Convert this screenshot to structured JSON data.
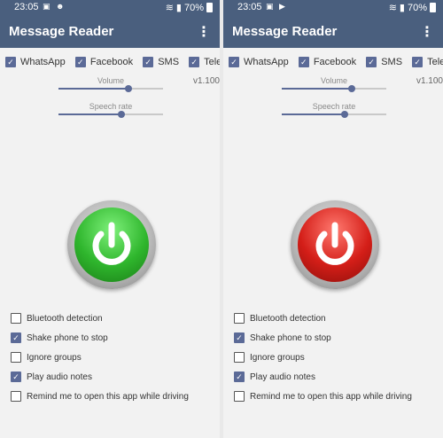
{
  "screens": [
    {
      "status": {
        "time": "23:05",
        "battery": "70%"
      },
      "app_title": "Message Reader",
      "apps": [
        {
          "label": "WhatsApp",
          "checked": true
        },
        {
          "label": "Facebook",
          "checked": true
        },
        {
          "label": "SMS",
          "checked": true
        },
        {
          "label": "Telegram",
          "checked": true
        }
      ],
      "version": "v1.100",
      "volume": {
        "label": "Volume",
        "level": 0.67
      },
      "speech_rate": {
        "label": "Speech rate",
        "level": 0.6
      },
      "power": {
        "state": "on",
        "color": "#2fb62d"
      },
      "options": [
        {
          "label": "Bluetooth detection",
          "checked": false
        },
        {
          "label": "Shake phone to stop",
          "checked": true
        },
        {
          "label": "Ignore groups",
          "checked": false
        },
        {
          "label": "Play audio notes",
          "checked": true
        },
        {
          "label": "Remind me to open this app while driving",
          "checked": false
        }
      ]
    },
    {
      "status": {
        "time": "23:05",
        "battery": "70%"
      },
      "app_title": "Message Reader",
      "apps": [
        {
          "label": "WhatsApp",
          "checked": true
        },
        {
          "label": "Facebook",
          "checked": true
        },
        {
          "label": "SMS",
          "checked": true
        },
        {
          "label": "Telegram",
          "checked": true
        }
      ],
      "version": "v1.100",
      "volume": {
        "label": "Volume",
        "level": 0.67
      },
      "speech_rate": {
        "label": "Speech rate",
        "level": 0.6
      },
      "power": {
        "state": "off",
        "color": "#d41e18"
      },
      "options": [
        {
          "label": "Bluetooth detection",
          "checked": false
        },
        {
          "label": "Shake phone to stop",
          "checked": true
        },
        {
          "label": "Ignore groups",
          "checked": false
        },
        {
          "label": "Play audio notes",
          "checked": true
        },
        {
          "label": "Remind me to open this app while driving",
          "checked": false
        }
      ]
    }
  ],
  "theme": {
    "primary": "#4a5f7e",
    "accent": "#5b6a97"
  }
}
